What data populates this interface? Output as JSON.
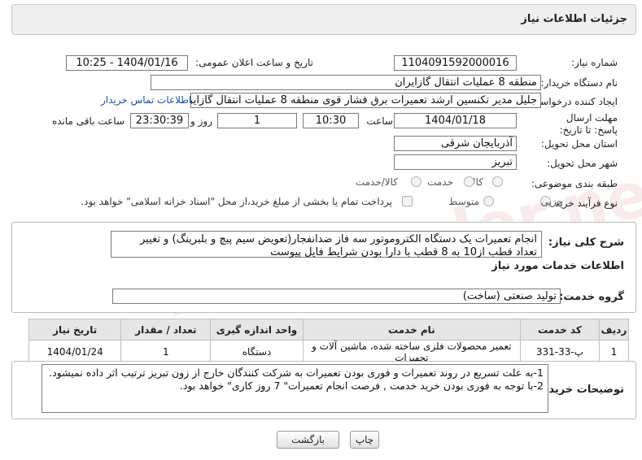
{
  "header": {
    "title": "جزئیات اطلاعات نیاز"
  },
  "fields": {
    "need_number_label": "شماره نیاز:",
    "need_number": "1104091592000016",
    "announce_label": "تاریخ و ساعت اعلان عمومی:",
    "announce_value": "1404/01/16 - 10:25",
    "buyer_org_label": "نام دستگاه خریدار:",
    "buyer_org": "منطقه 8 عملیات انتقال گازایران",
    "requester_label": "ایجاد کننده درخواست:",
    "requester": "جلیل مدیر تکنسین ارشد تعمیرات برق فشار قوی منطقه 8 عملیات انتقال گازایران",
    "contact_link": "اطلاعات تماس خریدار",
    "deadline_label": "مهلت ارسال پاسخ: تا تاریخ:",
    "deadline_date": "1404/01/18",
    "time_label": "ساعت",
    "deadline_time": "10:30",
    "days_value": "1",
    "days_label": "روز و",
    "remaining_time": "23:30:39",
    "remaining_label": "ساعت باقی مانده",
    "province_label": "استان محل تحویل:",
    "province": "آذربایجان شرقی",
    "city_label": "شهر محل تحویل:",
    "city": "تبریز",
    "category_label": "طبقه بندی موضوعی:",
    "category_options": [
      "کالا",
      "خدمت",
      "کالا/خدمت"
    ],
    "process_label": "نوع فرآیند خرید :",
    "process_options": [
      "جزیی",
      "متوسط"
    ],
    "payment_note": "پرداخت تمام یا بخشی از مبلغ خرید،از محل \"اسناد خزانه اسلامی\" خواهد بود."
  },
  "description": {
    "label": "شرح کلی نیاز:",
    "text": "انجام تعمیرات یک دستگاه الکتروموتور سه فاز ضدانفجار(تعویض سیم پیچ و بلبرینگ) و تغییر تعداد قطب از10 به 8 قطب با دارا بودن شرایط فایل پیوست"
  },
  "services": {
    "section_title": "اطلاعات خدمات مورد نیاز",
    "group_label": "گروه خدمت:",
    "group_value": "تولید صنعتی (ساخت)",
    "columns": [
      "ردیف",
      "کد خدمت",
      "نام خدمت",
      "واحد اندازه گیری",
      "تعداد / مقدار",
      "تاریخ نیاز"
    ],
    "rows": [
      [
        "1",
        "پ-33-331",
        "تعمیر محصولات فلزی ساخته شده، ماشین آلات و تجهیزات",
        "دستگاه",
        "1",
        "1404/01/24"
      ]
    ]
  },
  "buyer_notes": {
    "label": "توضیحات خریدار:",
    "line1": "1-به علت تسریع در روند تعمیرات و فوری بودن تعمیرات به شرکت کنندگان خارج از زون تبریز ترتیب اثر داده نمیشود.",
    "line2": "2-با توجه به فوری بودن خرید خدمت , فرصت انجام تعمیرات\" 7 روز کاری\" خواهد بود."
  },
  "buttons": {
    "print": "چاپ",
    "back": "بازگشت"
  },
  "watermark": "AriaTender.neT"
}
